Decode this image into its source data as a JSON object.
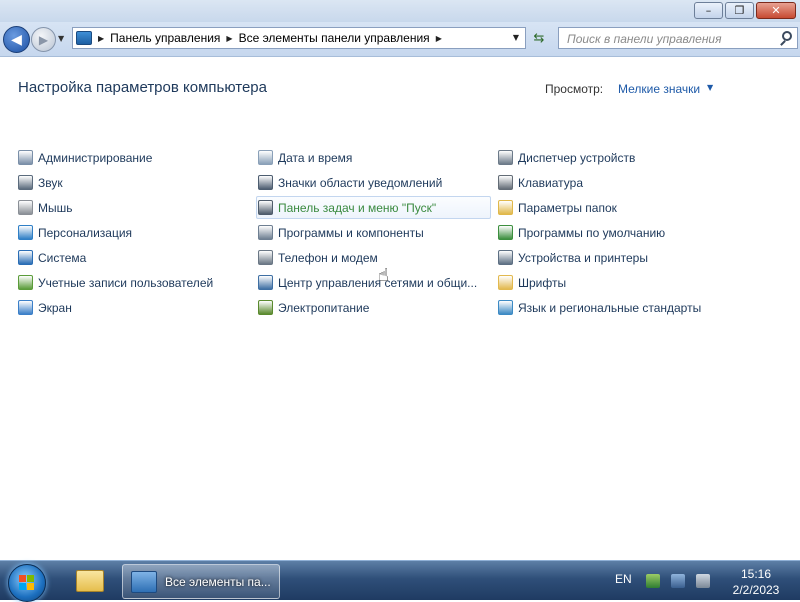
{
  "window": {
    "minimize_glyph": "–",
    "maximize_glyph": "❐",
    "close_glyph": "✕"
  },
  "navbar": {
    "back_glyph": "◀",
    "forward_glyph": "▶",
    "history_glyph": "▼",
    "breadcrumb": [
      "Панель управления",
      "Все элементы панели управления"
    ],
    "address_dropdown_glyph": "▼",
    "refresh_glyph": "⇆",
    "search_placeholder": "Поиск в панели управления"
  },
  "content": {
    "title": "Настройка параметров компьютера",
    "view_label": "Просмотр:",
    "view_value": "Мелкие значки",
    "view_dropdown_glyph": "▼",
    "columns": [
      [
        {
          "label": "Администрирование",
          "icon": "admin-tools-icon",
          "color": "#7a8fa8"
        },
        {
          "label": "Звук",
          "icon": "speaker-icon",
          "color": "#5b6b7d"
        },
        {
          "label": "Мышь",
          "icon": "mouse-icon",
          "color": "#8a8f96"
        },
        {
          "label": "Персонализация",
          "icon": "personalization-icon",
          "color": "#2f7fc6"
        },
        {
          "label": "Система",
          "icon": "system-icon",
          "color": "#2a6db5"
        },
        {
          "label": "Учетные записи пользователей",
          "icon": "user-accounts-icon",
          "color": "#5b9c3a"
        },
        {
          "label": "Экран",
          "icon": "display-icon",
          "color": "#3b7fc8"
        }
      ],
      [
        {
          "label": "Дата и время",
          "icon": "clock-calendar-icon",
          "color": "#8aa0b8"
        },
        {
          "label": "Значки области уведомлений",
          "icon": "notification-area-icon",
          "color": "#4d5d70"
        },
        {
          "label": "Панель задач и меню \"Пуск\"",
          "icon": "taskbar-start-icon",
          "color": "#4f5c6b",
          "hover": true
        },
        {
          "label": "Программы и компоненты",
          "icon": "programs-icon",
          "color": "#6e7f92"
        },
        {
          "label": "Телефон и модем",
          "icon": "phone-modem-icon",
          "color": "#6a7785"
        },
        {
          "label": "Центр управления сетями и общи...",
          "icon": "network-center-icon",
          "color": "#3f6fa3"
        },
        {
          "label": "Электропитание",
          "icon": "power-options-icon",
          "color": "#5a8a2e"
        }
      ],
      [
        {
          "label": "Диспетчер устройств",
          "icon": "device-manager-icon",
          "color": "#6c7a89"
        },
        {
          "label": "Клавиатура",
          "icon": "keyboard-icon",
          "color": "#636c76"
        },
        {
          "label": "Параметры папок",
          "icon": "folder-options-icon",
          "color": "#e0b84a"
        },
        {
          "label": "Программы по умолчанию",
          "icon": "default-programs-icon",
          "color": "#3c8f3f"
        },
        {
          "label": "Устройства и принтеры",
          "icon": "devices-printers-icon",
          "color": "#5d6f83"
        },
        {
          "label": "Шрифты",
          "icon": "fonts-icon",
          "color": "#e2b94f"
        },
        {
          "label": "Язык и региональные стандарты",
          "icon": "region-language-icon",
          "color": "#3c8ac4"
        }
      ]
    ]
  },
  "taskbar": {
    "app_label": "Все элементы па...",
    "language": "EN",
    "time": "15:16",
    "date": "2/2/2023"
  }
}
